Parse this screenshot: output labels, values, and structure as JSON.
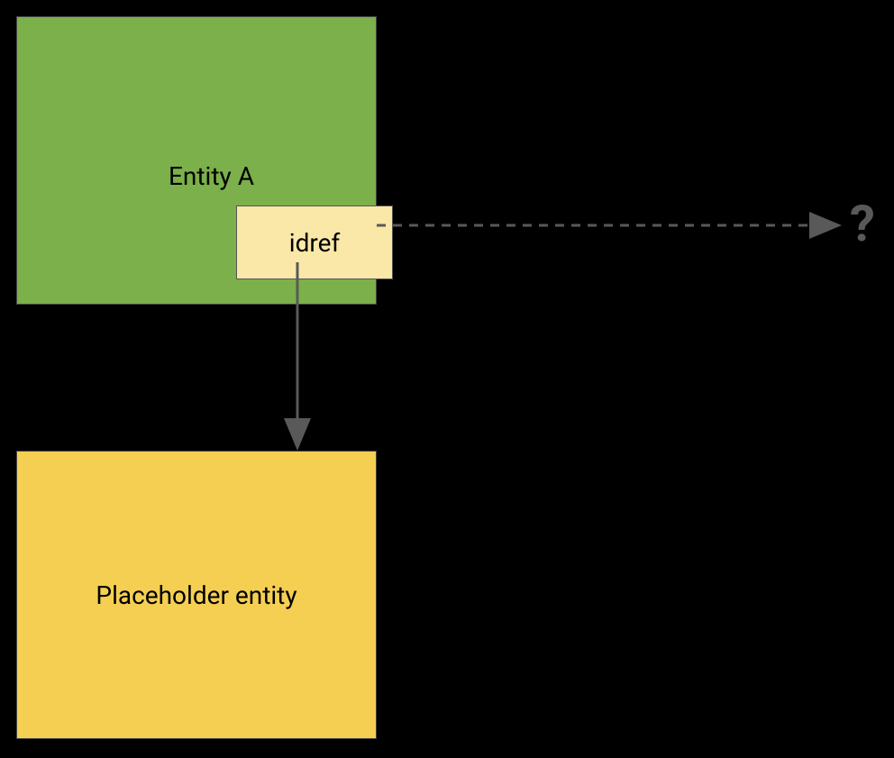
{
  "diagram": {
    "entity_a": {
      "label": "Entity A",
      "idref_label": "idref"
    },
    "placeholder_entity": {
      "label": "Placeholder entity"
    },
    "question_mark": "?"
  }
}
